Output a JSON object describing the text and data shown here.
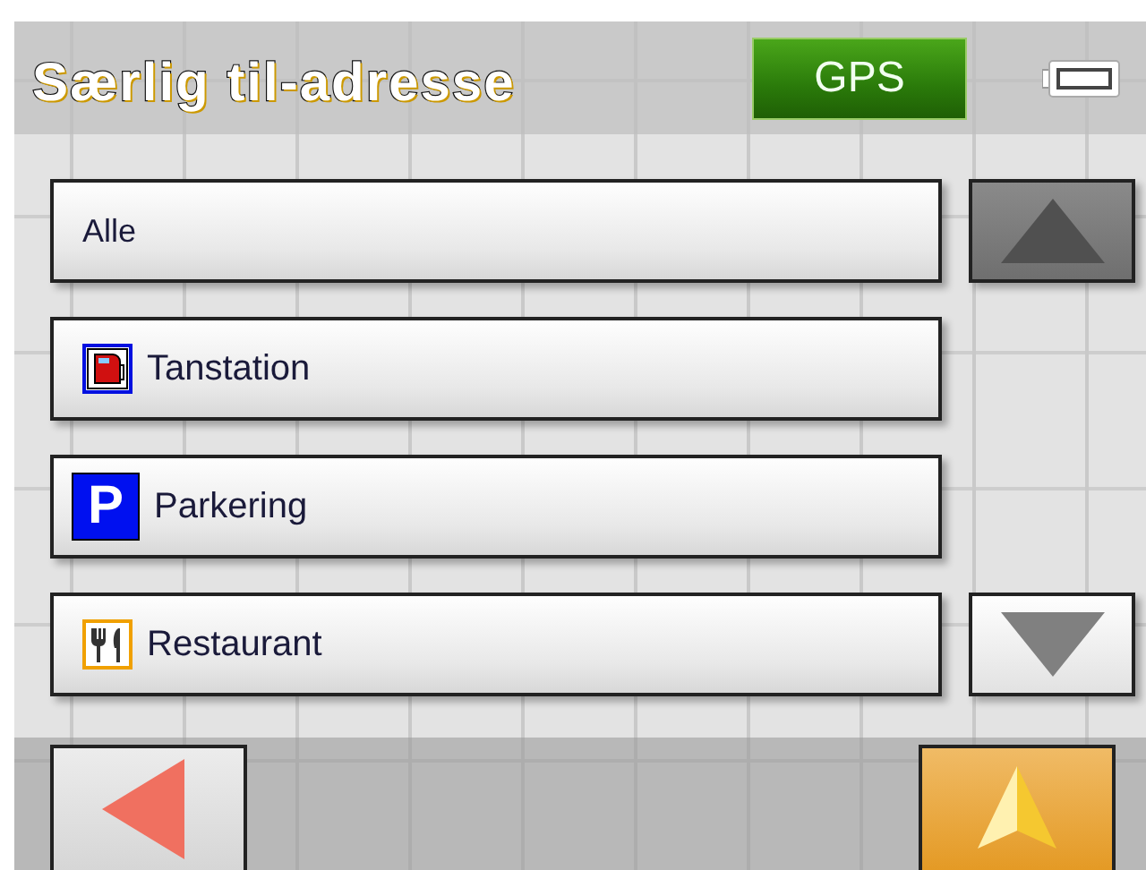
{
  "header": {
    "title": "Særlig til-adresse",
    "gps_label": "GPS"
  },
  "items": [
    {
      "kind": "plain",
      "label": "Alle"
    },
    {
      "kind": "fuel",
      "label": "Tanstation"
    },
    {
      "kind": "parking",
      "label": "Parkering",
      "icon_text": "P"
    },
    {
      "kind": "restaurant",
      "label": "Restaurant"
    }
  ],
  "scroll_up": {
    "disabled": true
  },
  "scroll_down": {
    "disabled": false
  }
}
